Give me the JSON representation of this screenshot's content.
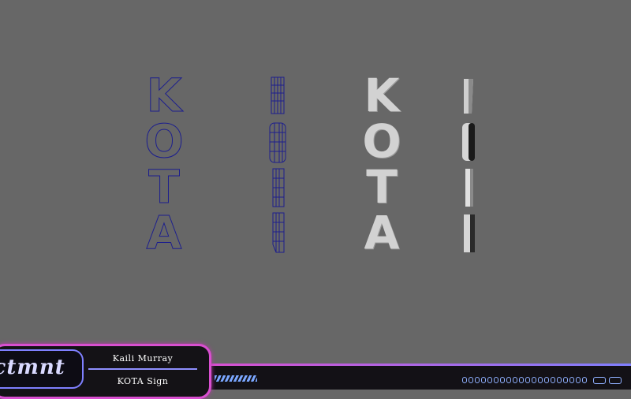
{
  "viewport": {
    "models": [
      {
        "style": "wireframe-front",
        "letters": [
          "K",
          "O",
          "T",
          "A"
        ]
      },
      {
        "style": "wireframe-side",
        "letters": [
          "K",
          "O",
          "T",
          "A"
        ]
      },
      {
        "style": "shaded-front",
        "letters": [
          "K",
          "O",
          "T",
          "A"
        ]
      },
      {
        "style": "shaded-side",
        "letters": [
          "K",
          "O",
          "T",
          "A"
        ]
      }
    ]
  },
  "overlay": {
    "logo_text": "ectmnt",
    "name": "Kaili Murray",
    "project": "KOTA Sign"
  },
  "colors": {
    "background": "#676767",
    "wireframe": "#1c1e8e",
    "panel_border": "#d94fd0",
    "accent": "#7f80ff"
  }
}
